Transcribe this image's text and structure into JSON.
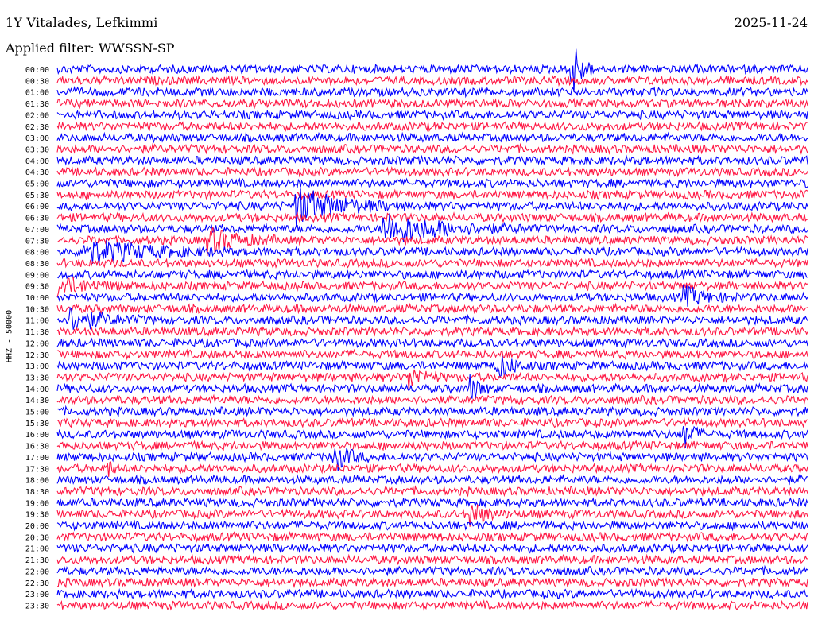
{
  "header": {
    "station": "1Y Vitalades, Lefkimmi",
    "date": "2025-11-24",
    "filter_prefix": "Applied filter:",
    "filter_name": "WWSSN-SP",
    "channel": "HHZ - 50000"
  },
  "colors": {
    "blue": "#0000ff",
    "red": "#ff1744",
    "background": "#ffffff"
  },
  "chart_data": {
    "type": "line",
    "title": "1Y Vitalades, Lefkimmi",
    "ylabel": "HHZ - 50000",
    "xlabel": "",
    "line_interval_minutes": 30,
    "color_cycle": [
      "blue",
      "red"
    ],
    "row_labels": [
      "00:00",
      "00:30",
      "01:00",
      "01:30",
      "02:00",
      "02:30",
      "03:00",
      "03:30",
      "04:00",
      "04:30",
      "05:00",
      "05:30",
      "06:00",
      "06:30",
      "07:00",
      "07:30",
      "08:00",
      "08:30",
      "09:00",
      "09:30",
      "10:00",
      "10:30",
      "11:00",
      "11:30",
      "12:00",
      "12:30",
      "13:00",
      "13:30",
      "14:00",
      "14:30",
      "15:00",
      "15:30",
      "16:00",
      "16:30",
      "17:00",
      "17:30",
      "18:00",
      "18:30",
      "19:00",
      "19:30",
      "20:00",
      "20:30",
      "21:00",
      "21:30",
      "22:00",
      "22:30",
      "23:00",
      "23:30"
    ],
    "events": [
      {
        "row": 0,
        "start_min": 20.5,
        "duration_min": 1.0,
        "amplitude": 12,
        "color": "red"
      },
      {
        "row": 12,
        "start_min": 9.5,
        "duration_min": 4.5,
        "amplitude": 6,
        "color": "red"
      },
      {
        "row": 14,
        "start_min": 13.0,
        "duration_min": 6.0,
        "amplitude": 5,
        "color": "blue"
      },
      {
        "row": 15,
        "start_min": 6.0,
        "duration_min": 3.0,
        "amplitude": 4,
        "color": "red"
      },
      {
        "row": 16,
        "start_min": 1.0,
        "duration_min": 6.0,
        "amplitude": 4,
        "color": "blue"
      },
      {
        "row": 19,
        "start_min": 0.0,
        "duration_min": 3.0,
        "amplitude": 3,
        "color": "red"
      },
      {
        "row": 20,
        "start_min": 25.0,
        "duration_min": 2.5,
        "amplitude": 3,
        "color": "blue"
      },
      {
        "row": 22,
        "start_min": 0.5,
        "duration_min": 3.0,
        "amplitude": 4,
        "color": "blue"
      },
      {
        "row": 26,
        "start_min": 17.5,
        "duration_min": 1.5,
        "amplitude": 5,
        "color": "blue"
      },
      {
        "row": 27,
        "start_min": 14.0,
        "duration_min": 1.5,
        "amplitude": 4,
        "color": "red"
      },
      {
        "row": 28,
        "start_min": 16.5,
        "duration_min": 1.0,
        "amplitude": 4,
        "color": "blue"
      },
      {
        "row": 32,
        "start_min": 25.0,
        "duration_min": 1.0,
        "amplitude": 5,
        "color": "blue"
      },
      {
        "row": 34,
        "start_min": 11.0,
        "duration_min": 1.5,
        "amplitude": 5,
        "color": "blue"
      },
      {
        "row": 35,
        "start_min": 2.0,
        "duration_min": 0.5,
        "amplitude": 3,
        "color": "red"
      },
      {
        "row": 39,
        "start_min": 16.5,
        "duration_min": 1.5,
        "amplitude": 4,
        "color": "red"
      }
    ]
  }
}
